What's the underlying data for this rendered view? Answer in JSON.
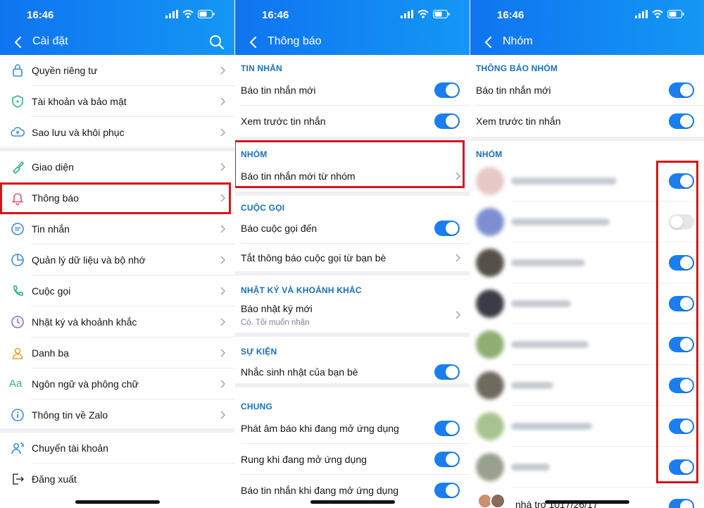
{
  "status_bar": {
    "time": "16:46"
  },
  "settings": {
    "title": "Cài đặt",
    "items": [
      {
        "label": "Quyền riêng tư",
        "icon": "lock-icon"
      },
      {
        "label": "Tài khoản và bảo mật",
        "icon": "shield-icon"
      },
      {
        "label": "Sao lưu và khôi phục",
        "icon": "cloud-icon"
      },
      {
        "label": "Giao diện",
        "icon": "brush-icon"
      },
      {
        "label": "Thông báo",
        "icon": "bell-icon"
      },
      {
        "label": "Tin nhắn",
        "icon": "chat-icon"
      },
      {
        "label": "Quản lý dữ liệu và bộ nhớ",
        "icon": "pie-chart-icon"
      },
      {
        "label": "Cuộc gọi",
        "icon": "phone-icon"
      },
      {
        "label": "Nhật ký và khoảnh khắc",
        "icon": "clock-icon"
      },
      {
        "label": "Danh bạ",
        "icon": "contact-icon"
      },
      {
        "label": "Ngôn ngữ và phông chữ",
        "icon": "font-icon",
        "icon_text": "Aa"
      },
      {
        "label": "Thông tin về Zalo",
        "icon": "info-icon"
      },
      {
        "label": "Chuyển tài khoản",
        "icon": "switch-account-icon"
      },
      {
        "label": "Đăng xuất",
        "icon": "logout-icon"
      }
    ]
  },
  "notifications": {
    "title": "Thông báo",
    "sections": {
      "messages": {
        "header": "TIN NHẮN",
        "new_message": "Báo tin nhắn mới",
        "preview": "Xem trước tin nhắn"
      },
      "groups": {
        "header": "NHÓM",
        "group_messages": "Báo tin nhắn mới từ nhóm"
      },
      "calls": {
        "header": "CUỘC GỌI",
        "incoming": "Báo cuộc gọi đến",
        "disable_friends": "Tắt thông báo cuộc gọi từ bạn bè"
      },
      "journal": {
        "header": "NHẬT KÝ VÀ KHOẢNH KHẮC",
        "new_journal": "Báo nhật ký mới",
        "new_journal_sub": "Có. Tôi muốn nhận"
      },
      "events": {
        "header": "SỰ KIỆN",
        "birthday": "Nhắc sinh nhật của bạn bè"
      },
      "general": {
        "header": "CHUNG",
        "sound_in_app": "Phát âm báo khi đang mở ứng dụng",
        "vibrate_in_app": "Rung khi đang mở ứng dụng",
        "notify_in_app": "Báo tin nhắn khi đang mở ứng dụng"
      }
    }
  },
  "groups": {
    "title": "Nhóm",
    "group_notif_header": "THÔNG BÁO NHÓM",
    "new_message": "Báo tin nhắn mới",
    "preview": "Xem trước tin nhắn",
    "list_header": "NHÓM",
    "last_group_name": "nhà trọ 1017/26/17",
    "group_toggles": [
      true,
      false,
      true,
      true,
      true,
      true,
      true,
      true
    ]
  },
  "colors": {
    "brand_blue": "#1a7ef0",
    "highlight_red": "#d7141a",
    "section_header": "#1a6fb9"
  }
}
